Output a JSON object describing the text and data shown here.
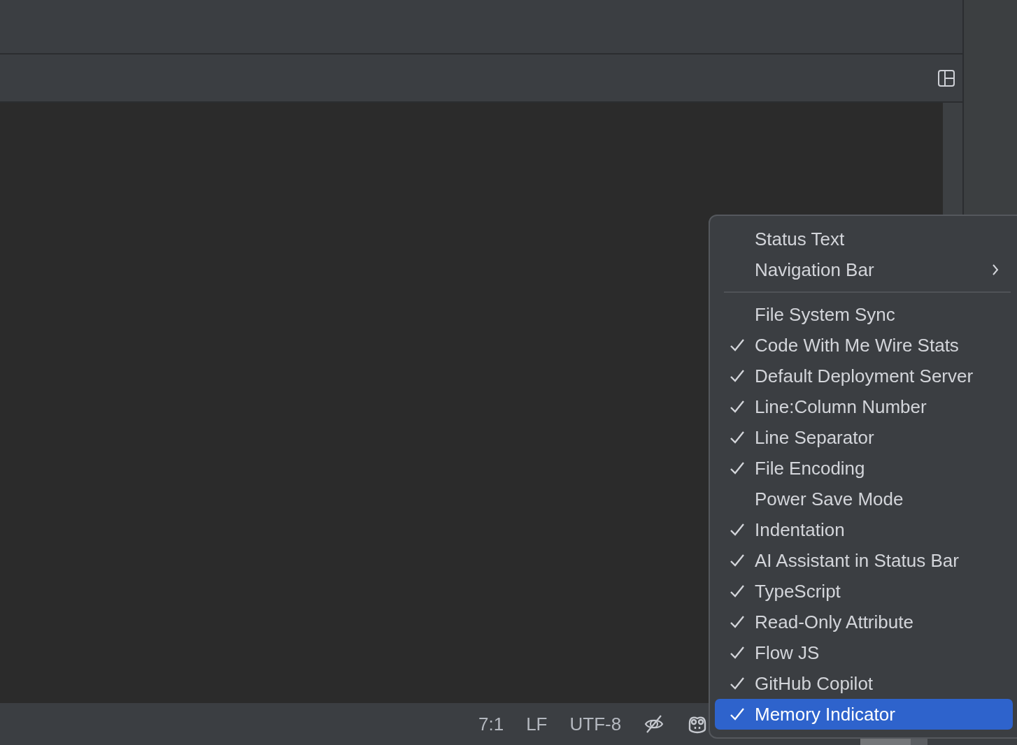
{
  "status_bar": {
    "items": [
      {
        "text": "7:1"
      },
      {
        "text": "LF"
      },
      {
        "text": "UTF-8"
      }
    ]
  },
  "context_menu": {
    "sections": [
      {
        "items": [
          {
            "label": "Status Text",
            "kind": "plain",
            "checked": false,
            "selected": false
          },
          {
            "label": "Navigation Bar",
            "kind": "submenu",
            "checked": false,
            "selected": false
          }
        ]
      },
      {
        "items": [
          {
            "label": "File System Sync",
            "kind": "check",
            "checked": false,
            "selected": false
          },
          {
            "label": "Code With Me Wire Stats",
            "kind": "check",
            "checked": true,
            "selected": false
          },
          {
            "label": "Default Deployment Server",
            "kind": "check",
            "checked": true,
            "selected": false
          },
          {
            "label": "Line:Column Number",
            "kind": "check",
            "checked": true,
            "selected": false
          },
          {
            "label": "Line Separator",
            "kind": "check",
            "checked": true,
            "selected": false
          },
          {
            "label": "File Encoding",
            "kind": "check",
            "checked": true,
            "selected": false
          },
          {
            "label": "Power Save Mode",
            "kind": "check",
            "checked": false,
            "selected": false
          },
          {
            "label": "Indentation",
            "kind": "check",
            "checked": true,
            "selected": false
          },
          {
            "label": "AI Assistant in Status Bar",
            "kind": "check",
            "checked": true,
            "selected": false
          },
          {
            "label": "TypeScript",
            "kind": "check",
            "checked": true,
            "selected": false
          },
          {
            "label": "Read-Only Attribute",
            "kind": "check",
            "checked": true,
            "selected": false
          },
          {
            "label": "Flow JS",
            "kind": "check",
            "checked": true,
            "selected": false
          },
          {
            "label": "GitHub Copilot",
            "kind": "check",
            "checked": true,
            "selected": false
          },
          {
            "label": "Memory Indicator",
            "kind": "check",
            "checked": true,
            "selected": true
          }
        ]
      }
    ]
  }
}
